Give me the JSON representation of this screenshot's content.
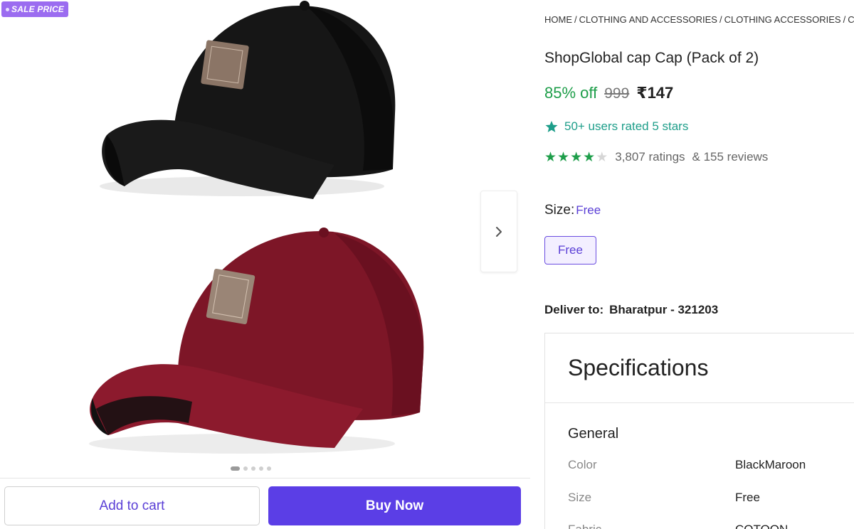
{
  "gallery": {
    "badge": "SALE PRICE",
    "image_alt": "Black and maroon caps",
    "dots": 5,
    "active_dot": 0
  },
  "actions": {
    "add_to_cart": "Add to cart",
    "buy_now": "Buy Now"
  },
  "breadcrumb": [
    "HOME",
    "CLOTHING AND ACCESSORIES",
    "CLOTHING ACCESSORIES",
    "C"
  ],
  "product": {
    "title": "ShopGlobal cap Cap (Pack of 2)",
    "discount": "85% off",
    "mrp": "999",
    "price": "₹147",
    "rating_banner": "50+ users rated 5 stars",
    "stars": 4,
    "ratings": "3,807 ratings",
    "reviews": "& 155 reviews"
  },
  "size": {
    "label": "Size:",
    "selected": "Free",
    "options": [
      "Free"
    ]
  },
  "delivery": {
    "label": "Deliver to:",
    "location": "Bharatpur - 321203"
  },
  "specifications": {
    "title": "Specifications",
    "group": "General",
    "rows": [
      {
        "key": "Color",
        "value": "BlackMaroon"
      },
      {
        "key": "Size",
        "value": "Free"
      },
      {
        "key": "Fabric",
        "value": "COTOON"
      }
    ]
  },
  "colors": {
    "accent": "#5b3ee6",
    "discount": "#1e9e4a",
    "badge": "#9b6cf0"
  }
}
